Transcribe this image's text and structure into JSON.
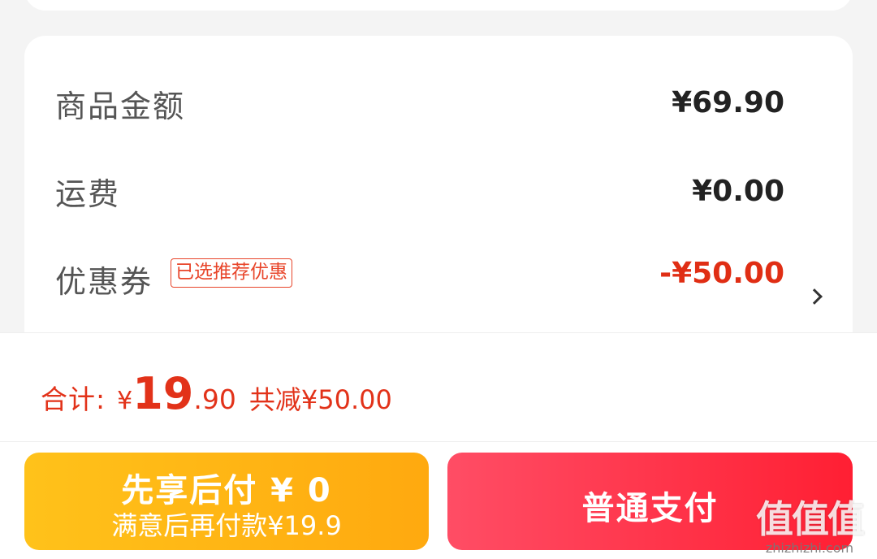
{
  "summary": {
    "items": [
      {
        "label": "商品金额",
        "value": "¥69.90"
      },
      {
        "label": "运费",
        "value": "¥0.00"
      },
      {
        "label": "优惠券",
        "tag": "已选推荐优惠",
        "value": "-¥50.00"
      }
    ]
  },
  "total": {
    "label": "合计:",
    "currency": "¥",
    "integer": "19",
    "decimal": ".90",
    "savings": "共减¥50.00"
  },
  "buttons": {
    "pay_later_title": "先享后付 ¥ 0",
    "pay_later_subtitle": "满意后再付款¥19.9",
    "pay_normal": "普通支付"
  },
  "watermark": {
    "logo": "值值值",
    "url": "zhizhizhi.com"
  },
  "colors": {
    "accent_red": "#e02e14",
    "pay_later_gradient": [
      "#ffc21a",
      "#ffa90f"
    ],
    "pay_normal_gradient": [
      "#ff4d65",
      "#ff1f33"
    ]
  }
}
